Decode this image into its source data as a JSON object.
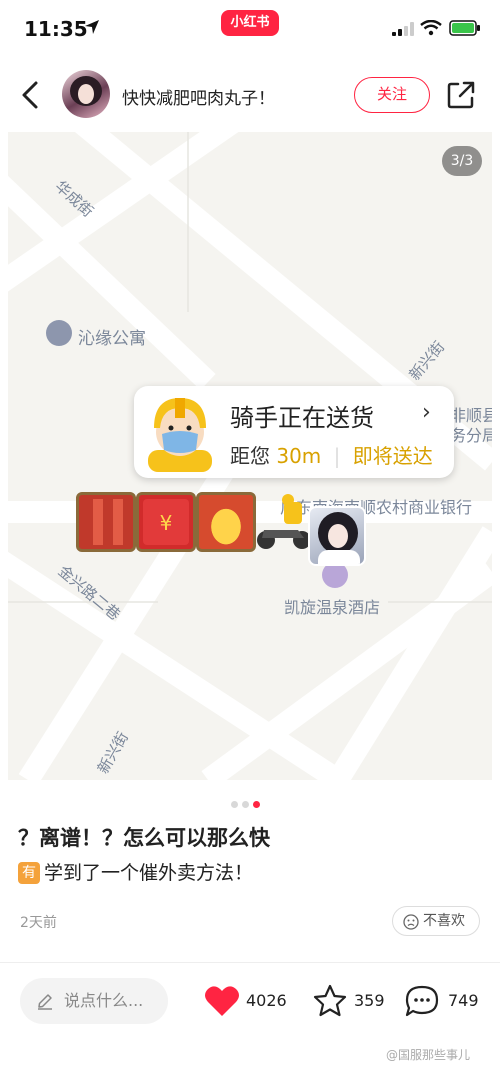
{
  "status_bar": {
    "time": "11:35",
    "brand": "小红书"
  },
  "header": {
    "author_name": "快快减肥吧肉丸子！",
    "follow_label": "关注"
  },
  "image": {
    "page_indicator": "3/3",
    "map_labels": {
      "street_huacheng": "华成街",
      "apartment": "沁缘公寓",
      "street_xinxing_right": "新兴街",
      "street_jinxing2": "金兴路二巷",
      "street_xinxing_bottom": "新兴街",
      "hotel": "凯旋温泉酒店",
      "bank": "广东南海南顺农村商业银行",
      "side_right_1": "非顺县",
      "side_right_2": "务分局"
    },
    "rider_card": {
      "title": "骑手正在送货",
      "distance_prefix": "距您",
      "distance": "30m",
      "eta": "即将送达"
    }
  },
  "post": {
    "title": "？离谱！？怎么可以那么快",
    "emoji_label": "有",
    "body": "学到了一个催外卖方法！",
    "date": "2天前",
    "dislike_label": "不喜欢"
  },
  "bottom_bar": {
    "comment_placeholder": "说点什么...",
    "likes": "4026",
    "favorites": "359",
    "comments": "749"
  },
  "watermark": "@国服那些事儿",
  "colors": {
    "brand_red": "#ff2442",
    "rider_yellow": "#d8a100"
  }
}
